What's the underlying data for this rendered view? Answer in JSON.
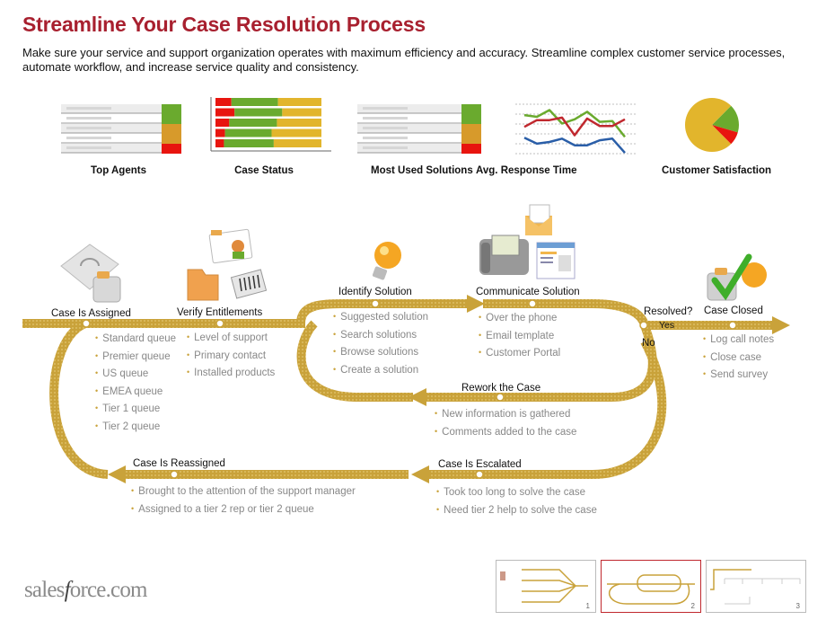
{
  "header": {
    "title": "Streamline Your Case Resolution Process",
    "description": "Make sure your service and support organization operates with maximum efficiency and accuracy. Streamline complex customer service processes, automate workflow, and increase service quality and consistency."
  },
  "widgets": [
    {
      "label": "Top Agents",
      "type": "ranked-list",
      "status_colors": [
        "#6aaa2e",
        "#6aaa2e",
        "#d79a2b",
        "#d79a2b",
        "#e8150f"
      ]
    },
    {
      "label": "Case Status",
      "type": "stacked-bar"
    },
    {
      "label": "Most Used Solutions",
      "type": "ranked-list",
      "status_colors": [
        "#6aaa2e",
        "#6aaa2e",
        "#d79a2b",
        "#d79a2b",
        "#e8150f"
      ]
    },
    {
      "label": "Avg. Response Time",
      "type": "line"
    },
    {
      "label": "Customer Satisfaction",
      "type": "pie"
    }
  ],
  "chart_data": [
    {
      "type": "bar",
      "title": "Case Status",
      "stacked": true,
      "orientation": "horizontal",
      "categories": [
        "1",
        "2",
        "3",
        "4",
        "5"
      ],
      "series": [
        {
          "name": "red",
          "color": "#e8150f",
          "values": [
            15,
            18,
            13,
            9,
            8
          ]
        },
        {
          "name": "green",
          "color": "#6aaa2e",
          "values": [
            44,
            45,
            45,
            44,
            47
          ]
        },
        {
          "name": "yellow",
          "color": "#e2b52c",
          "values": [
            41,
            37,
            42,
            47,
            45
          ]
        }
      ],
      "xlim": [
        0,
        100
      ]
    },
    {
      "type": "line",
      "title": "Avg. Response Time",
      "x": [
        1,
        2,
        3,
        4,
        5,
        6,
        7,
        8,
        9
      ],
      "series": [
        {
          "name": "green",
          "color": "#6aaa2e",
          "values": [
            4.2,
            4.0,
            4.8,
            3.2,
            3.7,
            4.6,
            3.4,
            3.5,
            1.6
          ]
        },
        {
          "name": "red",
          "color": "#c0282e",
          "values": [
            2.8,
            3.6,
            3.6,
            3.9,
            1.8,
            3.8,
            2.9,
            2.9,
            3.7
          ]
        },
        {
          "name": "blue",
          "color": "#2a5ea8",
          "values": [
            1.5,
            0.8,
            1.0,
            1.4,
            0.6,
            0.6,
            1.2,
            1.4,
            -0.3
          ]
        }
      ],
      "ylim": [
        -0.5,
        5.5
      ],
      "grid": true
    },
    {
      "type": "pie",
      "title": "Customer Satisfaction",
      "slices": [
        {
          "label": "yellow",
          "color": "#e2b52c",
          "value": 75
        },
        {
          "label": "green",
          "color": "#6aaa2e",
          "value": 17
        },
        {
          "label": "red",
          "color": "#e8150f",
          "value": 8
        }
      ]
    }
  ],
  "steps": [
    {
      "id": "assigned",
      "label": "Case Is Assigned",
      "bullets": [
        "Standard queue",
        "Premier queue",
        "US queue",
        "EMEA queue",
        "Tier 1 queue",
        "Tier 2 queue"
      ]
    },
    {
      "id": "verify",
      "label": "Verify Entitlements",
      "bullets": [
        "Level of support",
        "Primary contact",
        "Installed products"
      ]
    },
    {
      "id": "identify",
      "label": "Identify Solution",
      "bullets": [
        "Suggested solution",
        "Search solutions",
        "Browse solutions",
        "Create a solution"
      ]
    },
    {
      "id": "communicate",
      "label": "Communicate Solution",
      "bullets": [
        "Over the phone",
        "Email template",
        "Customer Portal"
      ]
    },
    {
      "id": "closed",
      "label": "Case Closed",
      "bullets": [
        "Log call notes",
        "Close case",
        "Send survey"
      ]
    },
    {
      "id": "rework",
      "label": "Rework the Case",
      "bullets": [
        "New information is gathered",
        "Comments added to the case"
      ]
    },
    {
      "id": "escalated",
      "label": "Case Is Escalated",
      "bullets": [
        "Took too long to solve the case",
        "Need tier 2 help to solve the case"
      ]
    },
    {
      "id": "reassigned",
      "label": "Case Is Reassigned",
      "bullets": [
        "Brought to the attention of the support manager",
        "Assigned to a tier 2 rep or tier 2 queue"
      ]
    }
  ],
  "decision": {
    "label": "Resolved?",
    "yes": "Yes",
    "no": "No"
  },
  "colors": {
    "title": "#a8202f",
    "track": "#c9a23a",
    "bullet_text": "#888888"
  },
  "footer": {
    "logo_pre": "sales",
    "logo_italic": "f",
    "logo_post": "orce.com",
    "thumbnails": [
      {
        "number": "1",
        "active": false
      },
      {
        "number": "2",
        "active": true
      },
      {
        "number": "3",
        "active": false
      }
    ]
  }
}
